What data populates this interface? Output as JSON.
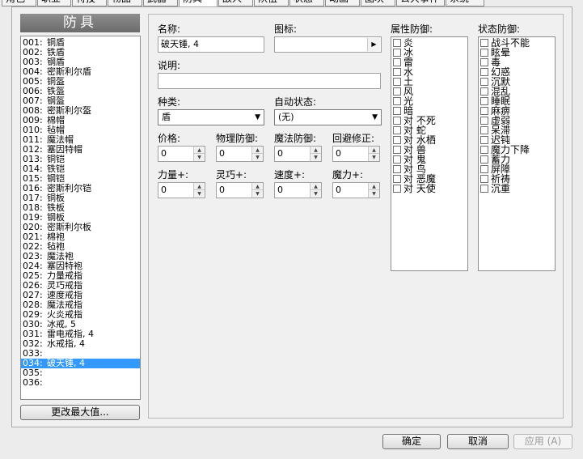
{
  "tabs": [
    "角色",
    "职业",
    "特技",
    "物品",
    "武器",
    "防具",
    "敌人",
    "队伍",
    "状态",
    "动画",
    "图块",
    "公共事件",
    "系统"
  ],
  "active_tab": "防具",
  "left": {
    "header": "防具",
    "items": [
      {
        "num": "001:",
        "name": "铜盾"
      },
      {
        "num": "002:",
        "name": "铁盾"
      },
      {
        "num": "003:",
        "name": "钢盾"
      },
      {
        "num": "004:",
        "name": "密斯利尔盾"
      },
      {
        "num": "005:",
        "name": "铜盔"
      },
      {
        "num": "006:",
        "name": "铁盔"
      },
      {
        "num": "007:",
        "name": "钢盔"
      },
      {
        "num": "008:",
        "name": "密斯利尔盔"
      },
      {
        "num": "009:",
        "name": "棉帽"
      },
      {
        "num": "010:",
        "name": "毡帽"
      },
      {
        "num": "011:",
        "name": "魔法帽"
      },
      {
        "num": "012:",
        "name": "塞因特帽"
      },
      {
        "num": "013:",
        "name": "铜铠"
      },
      {
        "num": "014:",
        "name": "铁铠"
      },
      {
        "num": "015:",
        "name": "钢铠"
      },
      {
        "num": "016:",
        "name": "密斯利尔铠"
      },
      {
        "num": "017:",
        "name": "铜板"
      },
      {
        "num": "018:",
        "name": "铁板"
      },
      {
        "num": "019:",
        "name": "钢板"
      },
      {
        "num": "020:",
        "name": "密斯利尔板"
      },
      {
        "num": "021:",
        "name": "棉袍"
      },
      {
        "num": "022:",
        "name": "毡袍"
      },
      {
        "num": "023:",
        "name": "魔法袍"
      },
      {
        "num": "024:",
        "name": "塞因特袍"
      },
      {
        "num": "025:",
        "name": "力量戒指"
      },
      {
        "num": "026:",
        "name": "灵巧戒指"
      },
      {
        "num": "027:",
        "name": "速度戒指"
      },
      {
        "num": "028:",
        "name": "魔法戒指"
      },
      {
        "num": "029:",
        "name": "火炎戒指"
      },
      {
        "num": "030:",
        "name": "冰戒, 5"
      },
      {
        "num": "031:",
        "name": "雷电戒指, 4"
      },
      {
        "num": "032:",
        "name": "水戒指, 4"
      },
      {
        "num": "033:",
        "name": ""
      },
      {
        "num": "034:",
        "name": "破天锤, 4"
      },
      {
        "num": "035:",
        "name": ""
      },
      {
        "num": "036:",
        "name": ""
      }
    ],
    "selected_index": 33,
    "change_max_button": "更改最大值..."
  },
  "form": {
    "name_label": "名称:",
    "name_value": "破天锤, 4",
    "icon_label": "图标:",
    "icon_button_glyph": "▶",
    "desc_label": "说明:",
    "desc_value": "",
    "kind_label": "种类:",
    "kind_value": "盾",
    "auto_state_label": "自动状态:",
    "auto_state_value": "(无)",
    "price_label": "价格:",
    "price_value": "0",
    "pdef_label": "物理防御:",
    "pdef_value": "0",
    "mdef_label": "魔法防御:",
    "mdef_value": "0",
    "eva_label": "回避修正:",
    "eva_value": "0",
    "str_label": "力量+:",
    "str_value": "0",
    "dex_label": "灵巧+:",
    "dex_value": "0",
    "agi_label": "速度+:",
    "agi_value": "0",
    "int_label": "魔力+:",
    "int_value": "0"
  },
  "element_defense": {
    "label": "属性防御:",
    "items": [
      "炎",
      "冰",
      "雷",
      "水",
      "土",
      "风",
      "光",
      "暗",
      "对 不死",
      "对 蛇",
      "对 水栖",
      "对 兽",
      "对 鬼",
      "对 鸟",
      "对 恶魔",
      "对 天使"
    ]
  },
  "state_defense": {
    "label": "状态防御:",
    "items": [
      "战斗不能",
      "眩晕",
      "毒",
      "幻惑",
      "沉默",
      "混乱",
      "睡眠",
      "麻痹",
      "虚弱",
      "呆滞",
      "迟钝",
      "魔力下降",
      "蓄力",
      "屏障",
      "祈祷",
      "沉重"
    ]
  },
  "buttons": {
    "ok": "确定",
    "cancel": "取消",
    "apply": "应用 (A)"
  }
}
